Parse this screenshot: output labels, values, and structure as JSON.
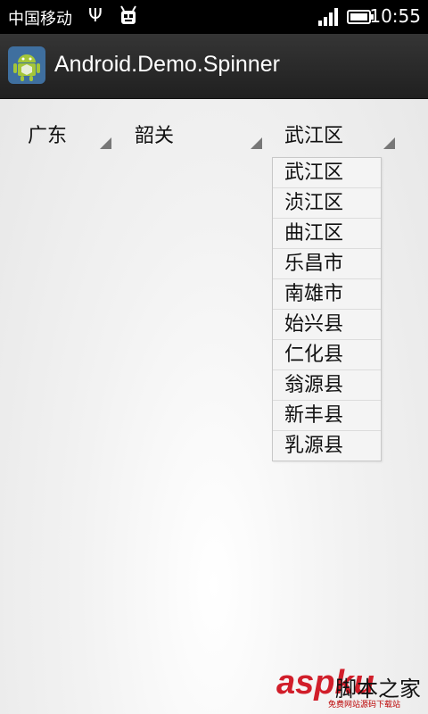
{
  "status_bar": {
    "carrier": "中国移动",
    "time": "10:55",
    "icons": [
      "usb-icon",
      "debug-icon",
      "signal-icon",
      "battery-icon"
    ]
  },
  "title_bar": {
    "title": "Android.Demo.Spinner",
    "icon": "android-app-icon"
  },
  "spinners": {
    "province": "广东",
    "city": "韶关",
    "district": "武江区"
  },
  "dropdown": {
    "options": [
      "武江区",
      "浈江区",
      "曲江区",
      "乐昌市",
      "南雄市",
      "始兴县",
      "仁化县",
      "翁源县",
      "新丰县",
      "乳源县"
    ]
  },
  "watermark": {
    "logo": "aspku",
    "tagline": "脚本之家",
    "small": "免费网站源码下载站"
  },
  "colors": {
    "status_bar_bg": "#000000",
    "title_bar_bg": "#2b2b2b",
    "watermark_red": "#d11e2a"
  }
}
